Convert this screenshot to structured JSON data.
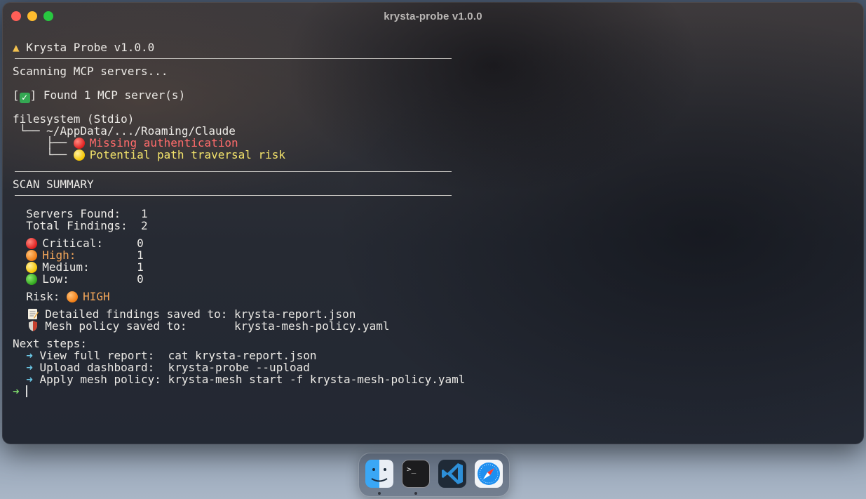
{
  "window": {
    "title": "krysta-probe v1.0.0"
  },
  "terminal": {
    "banner_icon": "warning-triangle-icon",
    "banner": "Krysta Probe v1.0.0",
    "scanning": "Scanning MCP servers...",
    "found_open": "[",
    "found_close": "] Found 1 MCP server(s)",
    "server": {
      "name": "filesystem (Stdio)",
      "path_prefix": " └── ",
      "path": "~/AppData/.../Roaming/Claude",
      "findings": [
        {
          "prefix": "     ├── ",
          "severity": "red",
          "text": "Missing authentication"
        },
        {
          "prefix": "     └── ",
          "severity": "yellow",
          "text": "Potential path traversal risk"
        }
      ]
    },
    "summary_title": "SCAN SUMMARY",
    "stats": {
      "servers_label": "  Servers Found:   ",
      "servers_value": "1",
      "findings_label": "  Total Findings:  ",
      "findings_value": "2"
    },
    "severity_counts": [
      {
        "dot": "red",
        "label": "Critical:",
        "pad": "     ",
        "value": "0",
        "highlight": false
      },
      {
        "dot": "orange",
        "label": "High:",
        "pad": "         ",
        "value": "1",
        "highlight": true
      },
      {
        "dot": "yellow",
        "label": "Medium:",
        "pad": "       ",
        "value": "1",
        "highlight": false
      },
      {
        "dot": "green",
        "label": "Low:",
        "pad": "          ",
        "value": "0",
        "highlight": false
      }
    ],
    "risk_label": "  Risk: ",
    "risk_value": "HIGH",
    "saved": {
      "report_label": "Detailed findings saved to: ",
      "report_file": "krysta-report.json",
      "policy_label": "Mesh policy saved to:       ",
      "policy_file": "krysta-mesh-policy.yaml"
    },
    "next_steps_title": "Next steps:",
    "next_steps": [
      {
        "arrow": "  ➜ ",
        "label": "View full report:  ",
        "command": "cat krysta-report.json"
      },
      {
        "arrow": "  ➜ ",
        "label": "Upload dashboard:  ",
        "command": "krysta-probe --upload"
      },
      {
        "arrow": "  ➜ ",
        "label": "Apply mesh policy: ",
        "command": "krysta-mesh start -f krysta-mesh-policy.yaml"
      }
    ],
    "prompt_arrow": "➜"
  },
  "dock": {
    "items": [
      {
        "name": "finder-icon"
      },
      {
        "name": "terminal-icon"
      },
      {
        "name": "vscode-icon"
      },
      {
        "name": "safari-icon"
      }
    ]
  },
  "colors": {
    "close": "#ff5f57",
    "minimize": "#febc2e",
    "maximize": "#28c840",
    "error_text": "#ff6b6b",
    "warn_text": "#f3e36b",
    "high_text": "#f3a65a",
    "arrow": "#6bc7e6",
    "prompt": "#7cd66a"
  }
}
